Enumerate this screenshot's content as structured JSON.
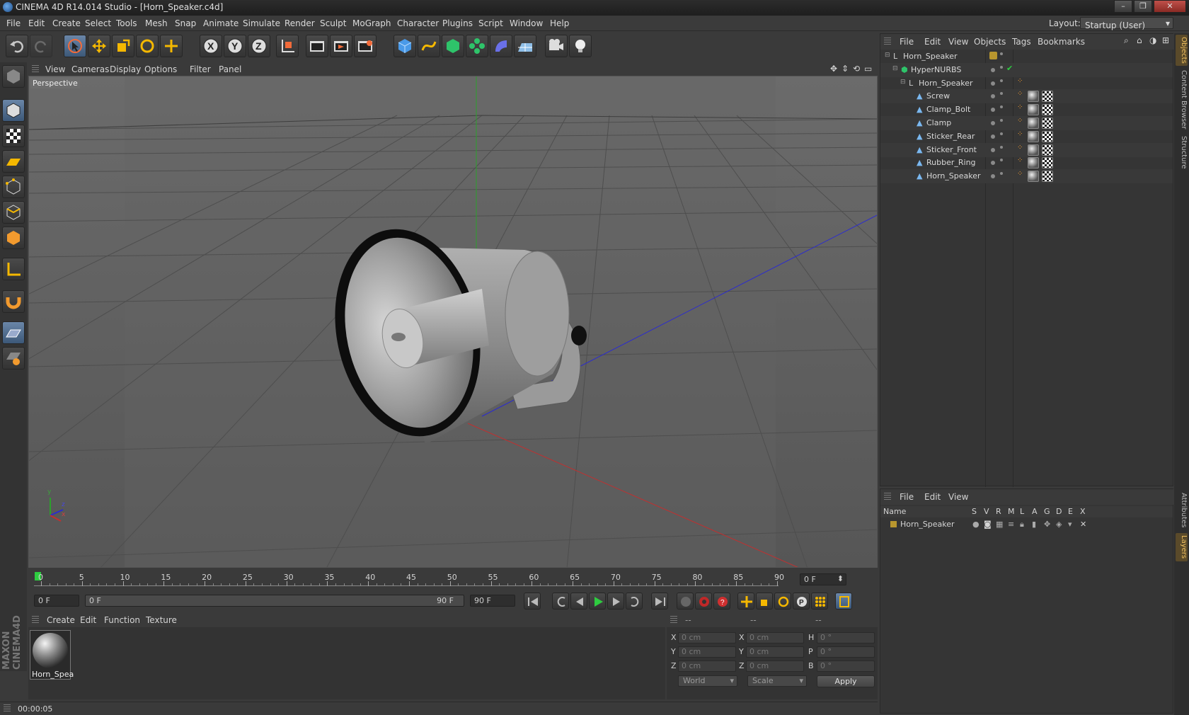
{
  "window": {
    "title": "CINEMA 4D R14.014 Studio - [Horn_Speaker.c4d]",
    "buttons": [
      "–",
      "❐",
      "✕"
    ]
  },
  "menubar": {
    "items": [
      "File",
      "Edit",
      "Create",
      "Select",
      "Tools",
      "Mesh",
      "Snap",
      "Animate",
      "Simulate",
      "Render",
      "Sculpt",
      "MoGraph",
      "Character",
      "Plugins",
      "Script",
      "Window",
      "Help"
    ],
    "layout_label": "Layout:",
    "layout_value": "Startup (User)"
  },
  "toolbar": {
    "tools": [
      "undo-icon",
      "redo-icon",
      "live-selection-icon",
      "move-icon",
      "scale-icon",
      "rotate-icon",
      "add-icon",
      "x-axis-icon",
      "y-axis-icon",
      "z-axis-icon",
      "world-coords-icon",
      "render-view-icon",
      "render-picture-viewer-icon",
      "edit-render-settings-icon",
      "cube-primitive-icon",
      "spline-icon",
      "nurbs-icon",
      "array-icon",
      "deformer-icon",
      "floor-icon",
      "camera-icon",
      "light-icon"
    ]
  },
  "viewport": {
    "menu": [
      "View",
      "Cameras",
      "Display",
      "Options",
      "Filter",
      "Panel"
    ],
    "label": "Perspective",
    "axes": {
      "y": "y",
      "z": "z",
      "x": "x"
    }
  },
  "timeline": {
    "ticks": [
      "0",
      "5",
      "10",
      "15",
      "20",
      "25",
      "30",
      "35",
      "40",
      "45",
      "50",
      "55",
      "60",
      "65",
      "70",
      "75",
      "80",
      "85",
      "90"
    ],
    "current_frame": "0 F",
    "start_field": "0 F",
    "range_start": "0 F",
    "range_end": "90 F",
    "end_field": "90 F"
  },
  "material_manager": {
    "menu": [
      "Create",
      "Edit",
      "Function",
      "Texture"
    ],
    "materials": [
      {
        "name": "Horn_Spea"
      }
    ]
  },
  "coordinates": {
    "headers": [
      "--",
      "--",
      "--"
    ],
    "rows": [
      {
        "a": "X",
        "av": "0 cm",
        "b": "X",
        "bv": "0 cm",
        "c": "H",
        "cv": "0 °"
      },
      {
        "a": "Y",
        "av": "0 cm",
        "b": "Y",
        "bv": "0 cm",
        "c": "P",
        "cv": "0 °"
      },
      {
        "a": "Z",
        "av": "0 cm",
        "b": "Z",
        "bv": "0 cm",
        "c": "B",
        "cv": "0 °"
      }
    ],
    "mode1": "World",
    "mode2": "Scale",
    "apply": "Apply"
  },
  "status": {
    "text": "00:00:05"
  },
  "object_manager": {
    "menu": [
      "File",
      "Edit",
      "View",
      "Objects",
      "Tags",
      "Bookmarks"
    ],
    "objects": [
      {
        "name": "Horn_Speaker",
        "type": "null",
        "level": 0
      },
      {
        "name": "HyperNURBS",
        "type": "nurbs",
        "level": 1
      },
      {
        "name": "Horn_Speaker",
        "type": "null",
        "level": 2
      },
      {
        "name": "Screw",
        "type": "poly",
        "level": 3
      },
      {
        "name": "Clamp_Bolt",
        "type": "poly",
        "level": 3
      },
      {
        "name": "Clamp",
        "type": "poly",
        "level": 3
      },
      {
        "name": "Sticker_Rear",
        "type": "poly",
        "level": 3
      },
      {
        "name": "Sticker_Front",
        "type": "poly",
        "level": 3
      },
      {
        "name": "Rubber_Ring",
        "type": "poly",
        "level": 3
      },
      {
        "name": "Horn_Speaker",
        "type": "poly",
        "level": 3
      }
    ]
  },
  "layer_manager": {
    "menu": [
      "File",
      "Edit",
      "View"
    ],
    "columns": [
      "Name",
      "S",
      "V",
      "R",
      "M",
      "L",
      "A",
      "G",
      "D",
      "E",
      "X"
    ],
    "layers": [
      {
        "name": "Horn_Speaker",
        "color": "#b8962e"
      }
    ]
  },
  "right_tabs": [
    "Objects",
    "Content Browser",
    "Structure",
    "Attributes",
    "Layers"
  ],
  "colors": {
    "accent": "#6a86a8",
    "layer": "#b8962e",
    "play": "#2ecc40"
  }
}
